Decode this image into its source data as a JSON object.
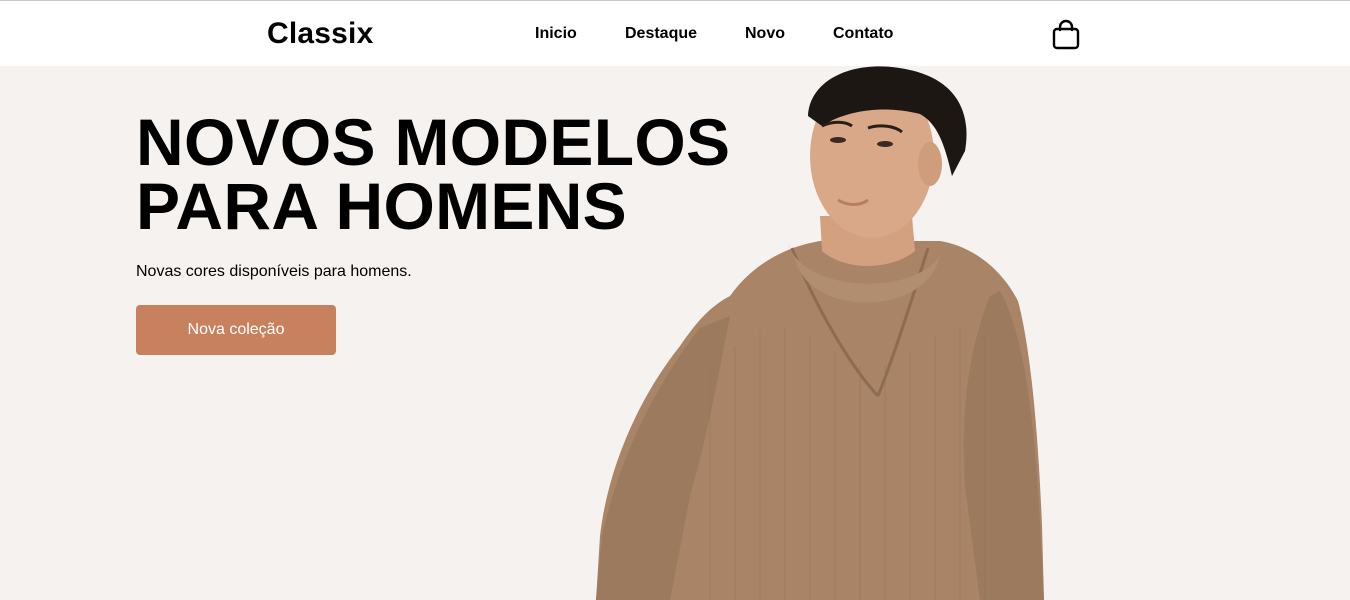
{
  "header": {
    "logo": "Classix",
    "nav": [
      "Inicio",
      "Destaque",
      "Novo",
      "Contato"
    ],
    "cart_icon": "shopping-bag-icon"
  },
  "hero": {
    "title_line1": "NOVOS MODELOS",
    "title_line2": "PARA HOMENS",
    "subtitle": "Novas cores disponíveis para homens.",
    "cta_label": "Nova coleção",
    "image": "man-in-brown-knit-sweater"
  },
  "colors": {
    "background": "#f6f2f0",
    "header_bg": "#ffffff",
    "accent": "#c8815f",
    "sweater": "#a98467",
    "skin": "#d9a888",
    "hair": "#1d1714"
  }
}
